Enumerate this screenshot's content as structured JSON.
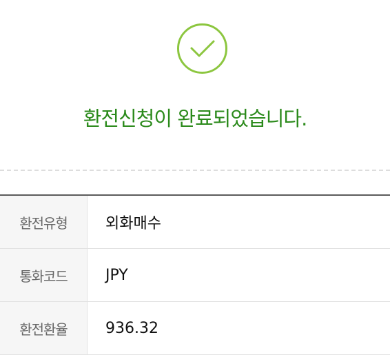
{
  "status": {
    "icon": "check-circle-icon",
    "accent_color": "#8cc63f",
    "title_color": "#2b8a1b",
    "message": "환전신청이 완료되었습니다."
  },
  "details": [
    {
      "label": "환전유형",
      "value": "외화매수"
    },
    {
      "label": "통화코드",
      "value": "JPY"
    },
    {
      "label": "환전환율",
      "value": "936.32"
    }
  ]
}
